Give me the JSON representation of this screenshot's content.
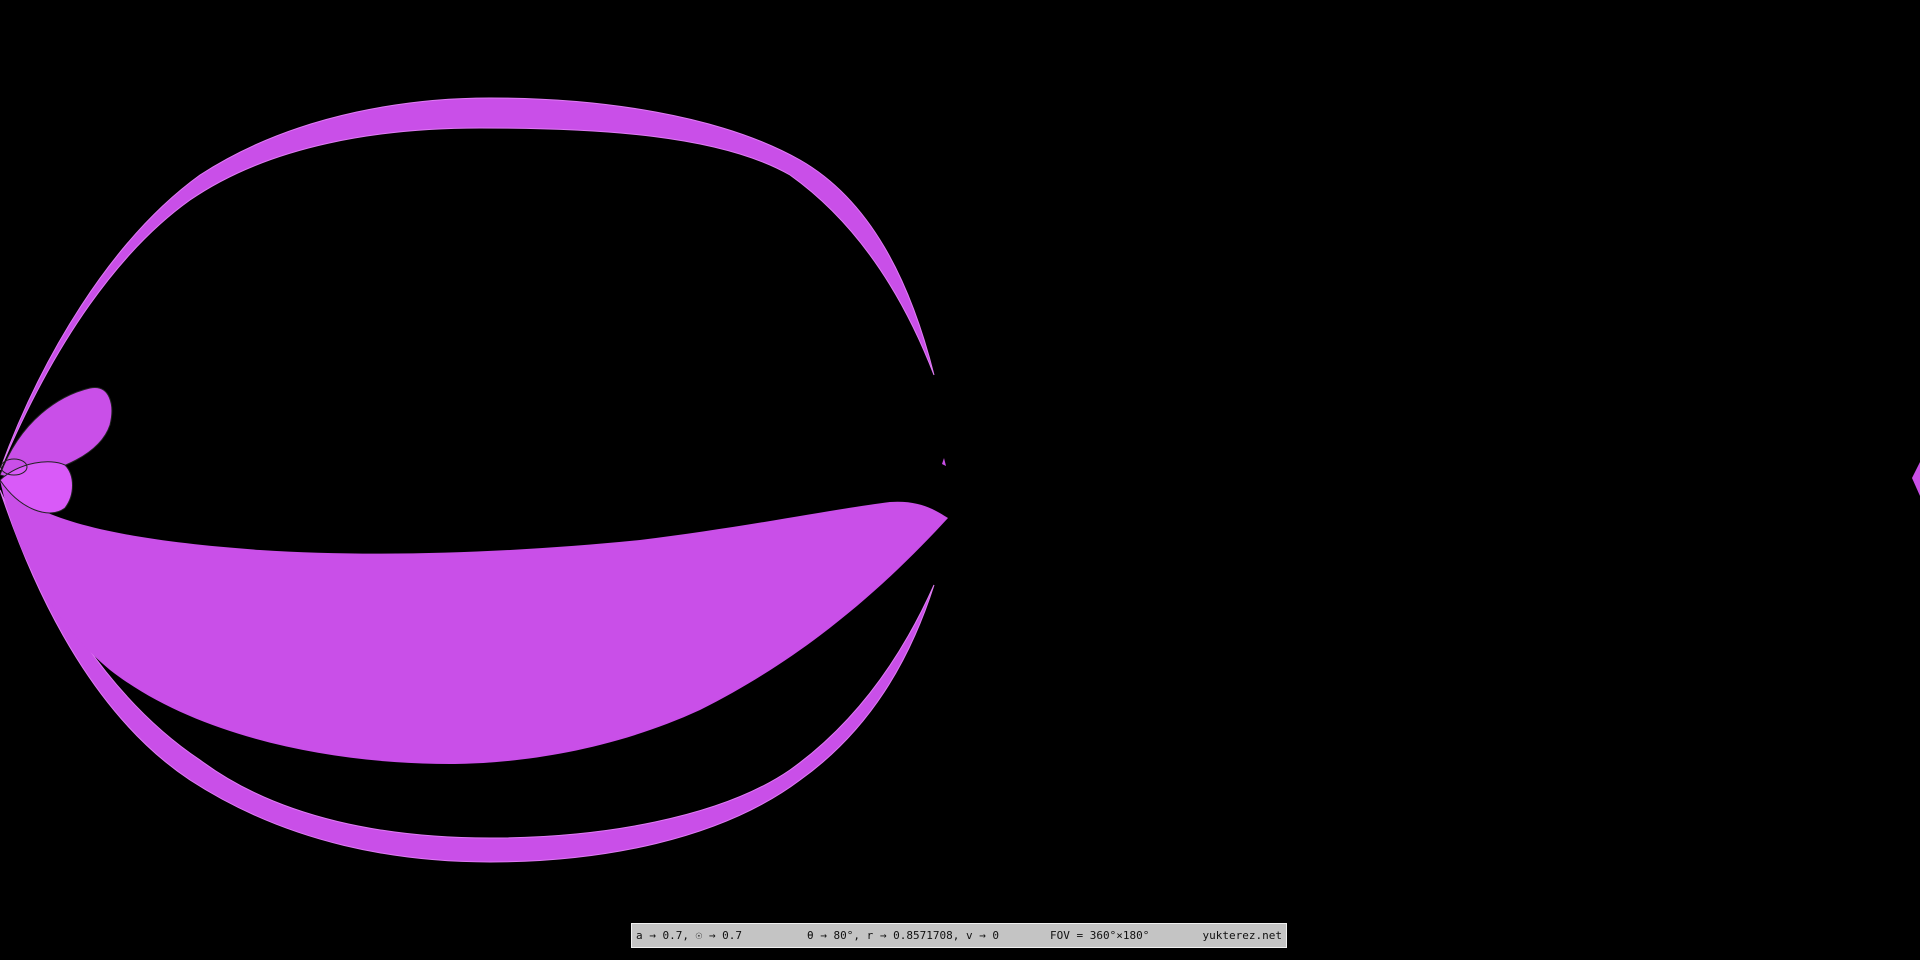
{
  "status_bar": {
    "spin": "a → 0.7, ☉ → 0.7",
    "orbit": "θ → 80°, r → 0.8571708, v → 0",
    "fov": "FOV = 360°×180°",
    "credit": "yukterez.net"
  },
  "colors": {
    "background": "#000000",
    "surface": "#c94fe8",
    "surface_highlight": "#e07cf5",
    "status_bar_bg": "#c4c4c4"
  }
}
